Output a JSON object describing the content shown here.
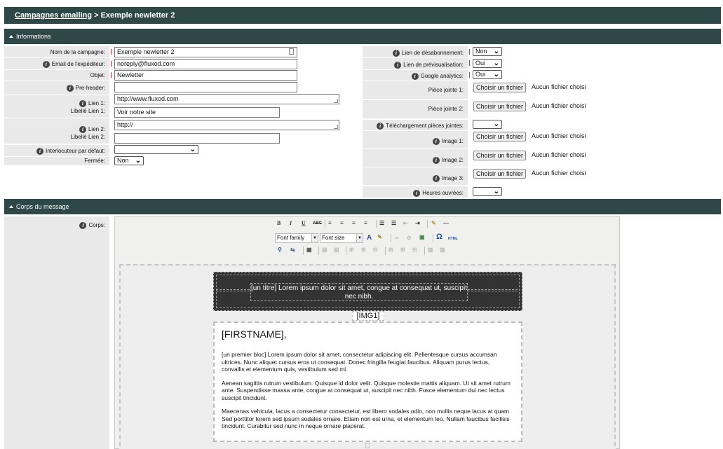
{
  "breadcrumb": {
    "link": "Campagnes emailing",
    "separator": " > ",
    "current": "Exemple newletter 2"
  },
  "informations": {
    "title": "Informations",
    "left": {
      "campaign_name": {
        "label": "Nom de la campagne:",
        "value": "Exemple newletter 2"
      },
      "sender_email": {
        "label": "Email de l'expéditeur:",
        "value": "noreply@fluxod.com"
      },
      "subject": {
        "label": "Objet:",
        "value": "Newletter"
      },
      "preheader": {
        "label": "Pre-header:",
        "value": ""
      },
      "link1": {
        "label": "Lien 1:",
        "value": "http://www.fluxod.com"
      },
      "link1_label": {
        "label": "Libellé Lien 1:",
        "value": "Voir notre site"
      },
      "link2": {
        "label": "Lien 2:",
        "value": "http://"
      },
      "link2_label": {
        "label": "Libellé Lien 2:",
        "value": ""
      },
      "default_contact": {
        "label": "Interlocuteur par défaut:",
        "value": ""
      },
      "closed": {
        "label": "Fermée:",
        "value": "Non"
      }
    },
    "right": {
      "unsubscribe_link": {
        "label": "Lien de désabonnement:",
        "value": "Non"
      },
      "preview_link": {
        "label": "Lien de prévisualisation:",
        "value": "Oui"
      },
      "google_analytics": {
        "label": "Google analytics:",
        "value": "Oui"
      },
      "attachment1": {
        "label": "Pièce jointe 1:"
      },
      "attachment2": {
        "label": "Pièce jointe 2:"
      },
      "attachment_download": {
        "label": "Téléchargement pièces jointes:",
        "value": ""
      },
      "image1": {
        "label": "Image 1:"
      },
      "image2": {
        "label": "Image 2:"
      },
      "image3": {
        "label": "Image 3:"
      },
      "working_hours": {
        "label": "Heures ouvrées:",
        "value": ""
      }
    },
    "file_button": "Choisir un fichier",
    "no_file": "Aucun fichier choisi"
  },
  "body_section": {
    "title": "Corps du message",
    "label": "Corps:",
    "toolbar": {
      "bold": "B",
      "italic": "I",
      "underline": "U",
      "strike": "ABC",
      "font_family": "Font family",
      "font_size": "Font size",
      "omega": "Ω",
      "html": "HTML"
    },
    "content": {
      "header": "[un titre] Lorem ipsum dolor sit amet, congue at consequat ut, suscipit nec nibh.",
      "img_tag": "[IMG1]",
      "greeting": "[FIRSTNAME],",
      "p1": "[un premier bloc] Lorem ipsum dolor sit amet, consectetur adipiscing elit. Pellentesque cursus accumsan ultrices. Nunc aliquet cursus eros ut consequat. Donec fringilla feugiat faucibus. Aliquam purus lectus, convallis et elementum quis, vestibulum sed mi.",
      "p2": "Aenean sagittis rutrum vestibulum. Quisque id dolor velit. Quisque molestie mattis aliquam. Ut sit amet rutrum ante. Suspendisse massa ante, congue at consequat ut, suscipit nec nibh. Fusce elementum dui nec lectus suscipit tincidunt.",
      "p3": "Maecenas vehicula, lacus a consectetur consectetur, est libero sodales odio, non mollis neque lacus at quam. Sed porttitor lorem sed ipsum sodales ornare. Etiam non est urna, et elementum leo. Nullam faucibus facilisis tincidunt. Curabitur sed nunc in neque ornare placerat."
    }
  },
  "colors": {
    "header_bg": "#2e4747",
    "label_bg": "#e9e9e9",
    "required": "#e03030",
    "newsletter_header_bg": "#333333"
  }
}
